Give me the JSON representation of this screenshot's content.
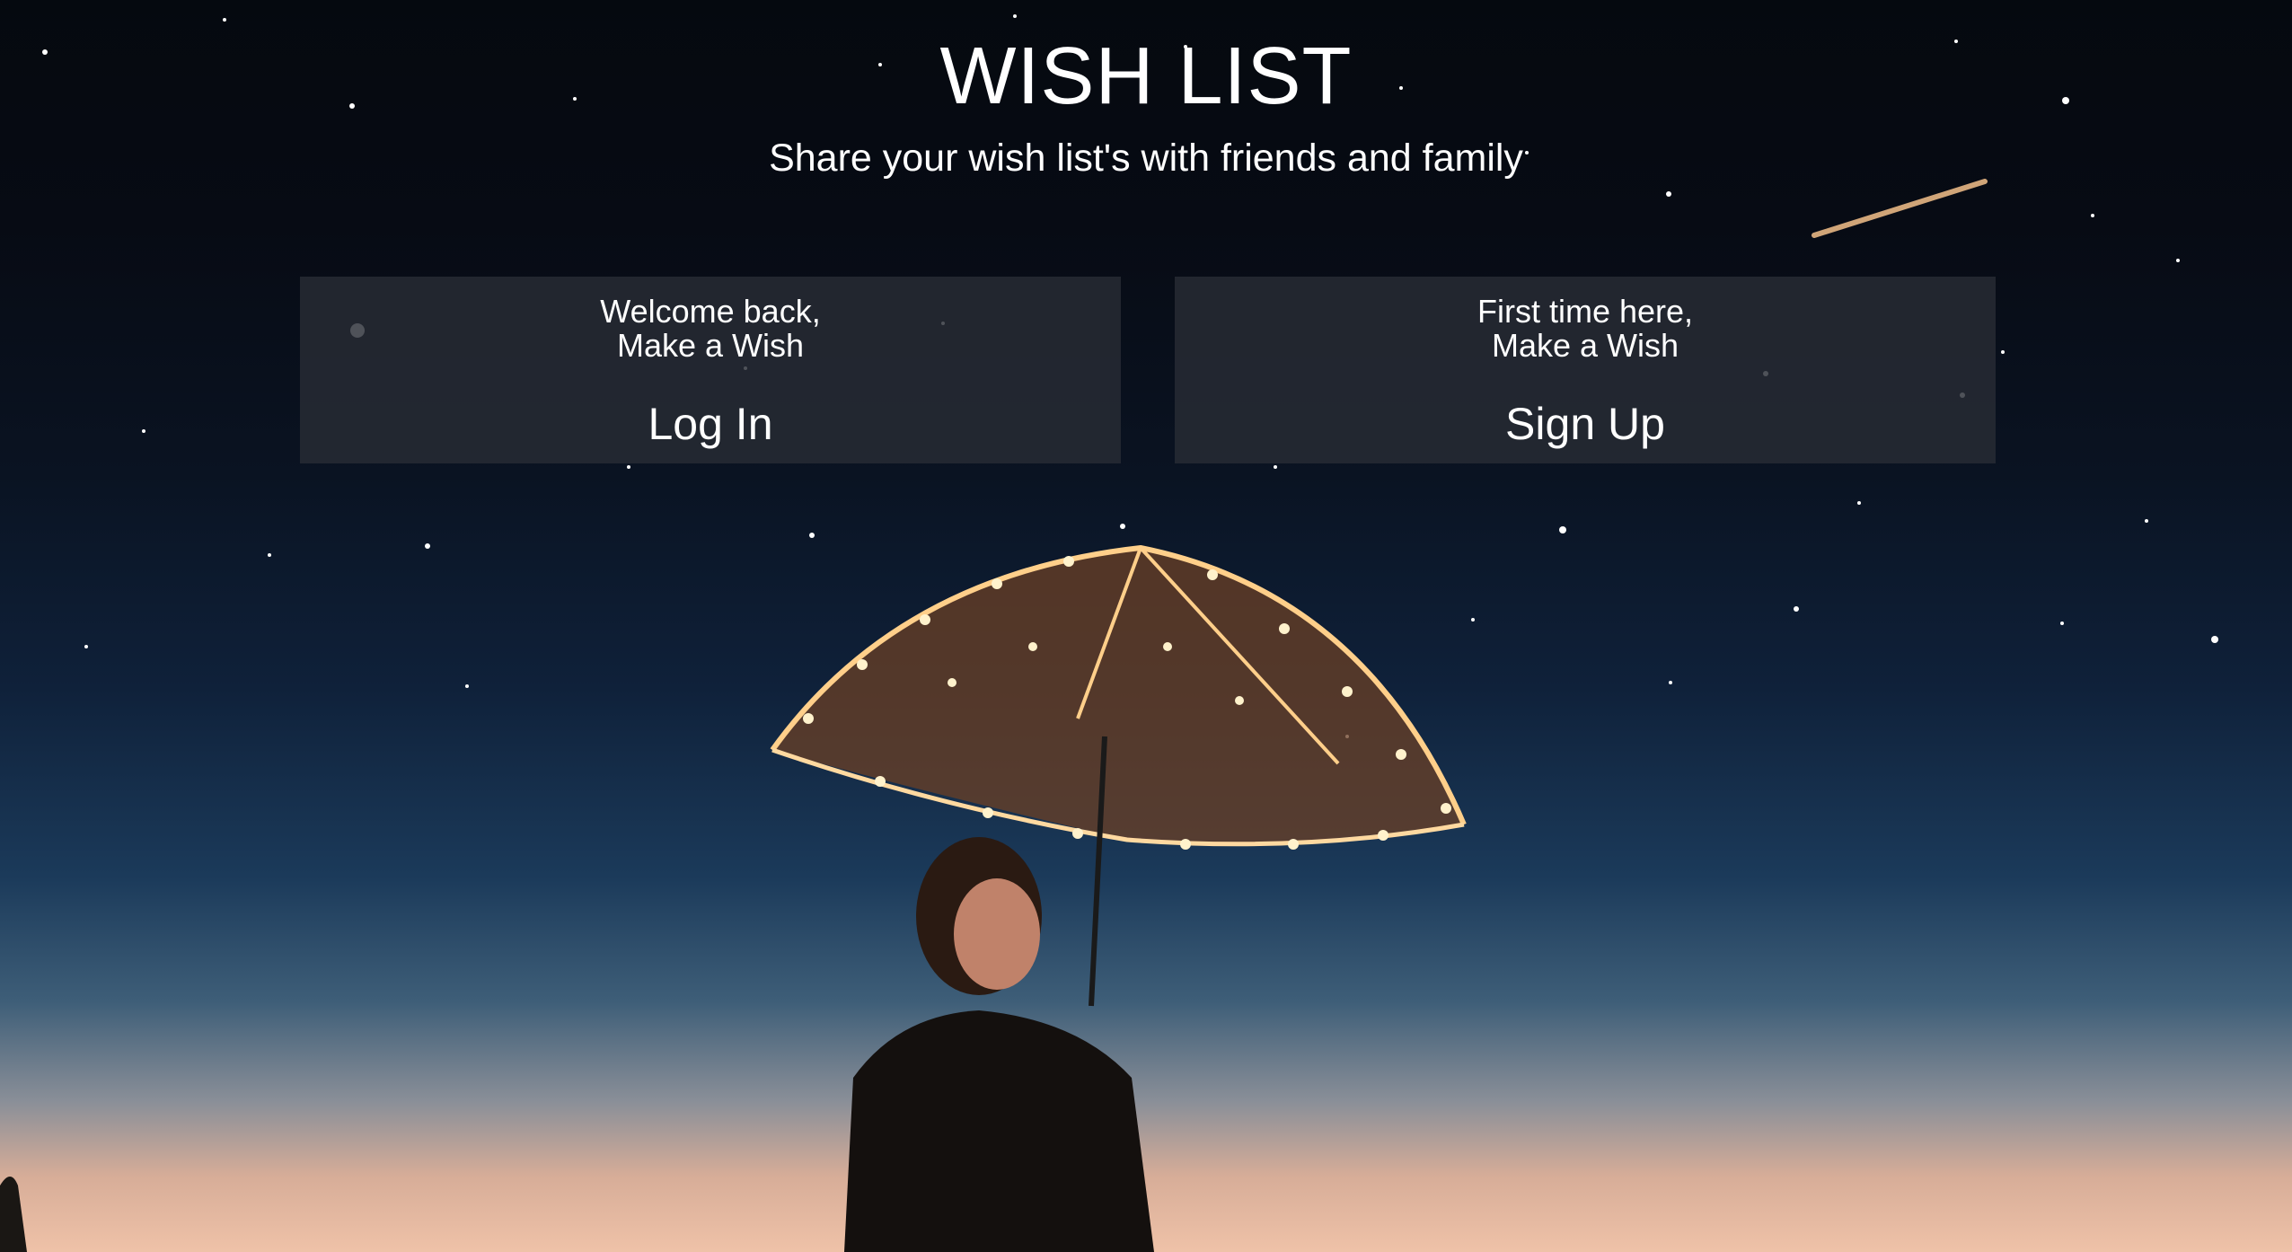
{
  "header": {
    "title": "WISH LIST",
    "subtitle": "Share your wish list's with friends and family"
  },
  "login_card": {
    "line1": "Welcome back,",
    "line2": "Make a Wish",
    "action": "Log In"
  },
  "signup_card": {
    "line1": "First time here,",
    "line2": "Make a Wish",
    "action": "Sign Up"
  },
  "colors": {
    "card_bg": "#282c34",
    "text": "#ffffff",
    "sky_top": "#05090f",
    "horizon": "#efc2a8"
  }
}
